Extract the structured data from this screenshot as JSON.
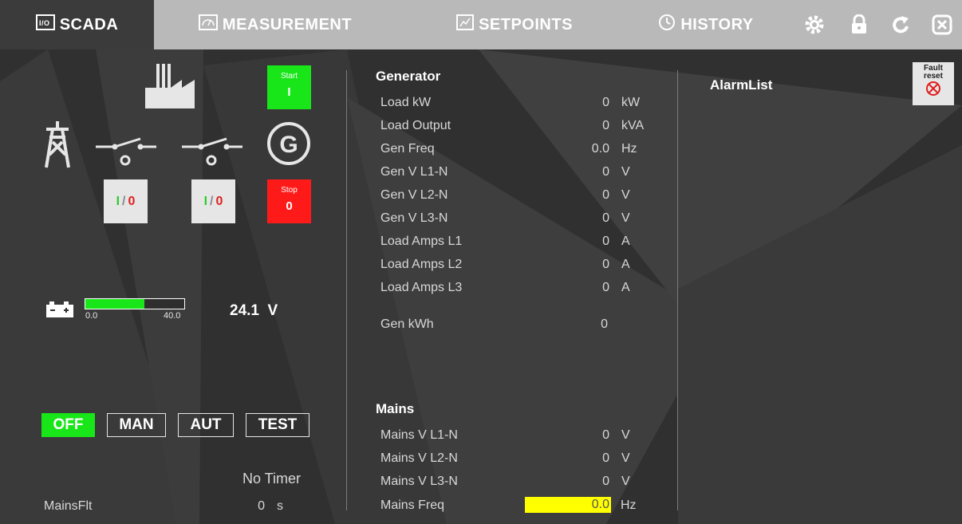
{
  "tabs": [
    {
      "label": "SCADA",
      "icon": "scada-icon",
      "active": true
    },
    {
      "label": "MEASUREMENT",
      "icon": "gauge-icon",
      "active": false
    },
    {
      "label": "SETPOINTS",
      "icon": "setpoints-icon",
      "active": false
    },
    {
      "label": "HISTORY",
      "icon": "history-clock-icon",
      "active": false
    }
  ],
  "toolbar_icons": [
    "gear-icon",
    "lock-icon",
    "refresh-icon",
    "close-icon"
  ],
  "controls": {
    "start_small": "Start",
    "start_big": "I",
    "stop_small": "Stop",
    "stop_big": "0",
    "breaker_io": {
      "i": "I",
      "sep": "/",
      "o": "0"
    }
  },
  "battery": {
    "min_label": "0.0",
    "max_label": "40.0",
    "level_fraction": 0.6,
    "reading": "24.1  V"
  },
  "modes": [
    {
      "label": "OFF",
      "active": true
    },
    {
      "label": "MAN",
      "active": false
    },
    {
      "label": "AUT",
      "active": false
    },
    {
      "label": "TEST",
      "active": false
    }
  ],
  "timer": {
    "text": "No Timer"
  },
  "mainsflt": {
    "label": "MainsFlt",
    "value": "0",
    "unit": "s"
  },
  "generator": {
    "title": "Generator",
    "rows": [
      {
        "label": "Load kW",
        "value": "0",
        "unit": "kW"
      },
      {
        "label": "Load Output",
        "value": "0",
        "unit": "kVA"
      },
      {
        "label": "Gen Freq",
        "value": "0.0",
        "unit": "Hz"
      },
      {
        "label": "Gen V L1-N",
        "value": "0",
        "unit": "V"
      },
      {
        "label": "Gen V L2-N",
        "value": "0",
        "unit": "V"
      },
      {
        "label": "Gen V L3-N",
        "value": "0",
        "unit": "V"
      },
      {
        "label": "Load Amps L1",
        "value": "0",
        "unit": "A"
      },
      {
        "label": "Load Amps L2",
        "value": "0",
        "unit": "A"
      },
      {
        "label": "Load Amps L3",
        "value": "0",
        "unit": "A"
      }
    ],
    "kwh_label": "Gen kWh",
    "kwh_value": "0"
  },
  "mains": {
    "title": "Mains",
    "rows": [
      {
        "label": "Mains V L1-N",
        "value": "0",
        "unit": "V"
      },
      {
        "label": "Mains V L2-N",
        "value": "0",
        "unit": "V"
      },
      {
        "label": "Mains V L3-N",
        "value": "0",
        "unit": "V"
      }
    ],
    "freq_label": "Mains Freq",
    "freq_value": "0.0",
    "freq_unit": "Hz",
    "highlight_color": "#ffff00"
  },
  "alarm": {
    "title": "AlarmList",
    "fault_reset_1": "Fault",
    "fault_reset_2": "reset"
  },
  "colors": {
    "start_green": "#19e619",
    "stop_red": "#ff1a1a",
    "active_tab": "#3b3b3b",
    "topbar": "#b9b9b9"
  }
}
